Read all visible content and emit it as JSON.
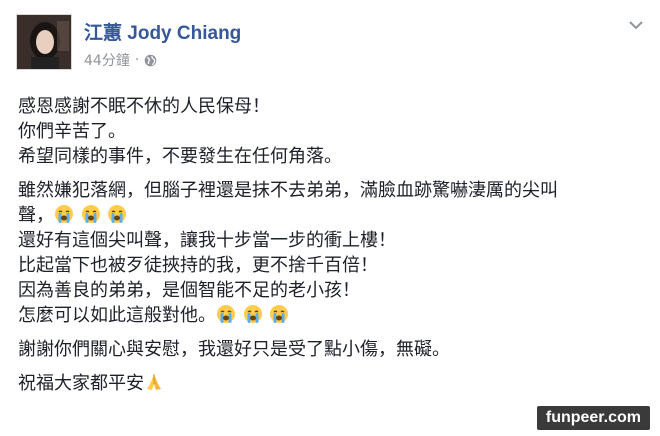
{
  "post": {
    "author": "江蕙 Jody Chiang",
    "time": "44分鐘",
    "separator": "·",
    "privacy_icon": "globe-icon",
    "menu_icon": "chevron-down-icon",
    "paragraphs": [
      [
        "感恩感謝不眠不休的人民保母！",
        "你們辛苦了。",
        "希望同樣的事件，不要發生在任何角落。"
      ],
      [
        "雖然嫌犯落網，但腦子裡還是抹不去弟弟，滿臉血跡驚嚇淒厲的尖叫",
        "聲，",
        "還好有這個尖叫聲，讓我十步當一步的衝上樓！",
        "比起當下也被歹徒挾持的我，更不捨千百倍！",
        "因為善良的弟弟，是個智能不足的老小孩！",
        "怎麼可以如此這般對他。"
      ],
      [
        "謝謝你們關心與安慰，我還好只是受了點小傷，無礙。"
      ],
      [
        "祝福大家都平安"
      ]
    ],
    "emojis": {
      "crying": "loudly-crying-face-icon",
      "pray": "folded-hands-icon"
    }
  },
  "watermark": "funpeer.com",
  "colors": {
    "author": "#365899",
    "meta": "#90949c",
    "text": "#1d2129"
  }
}
